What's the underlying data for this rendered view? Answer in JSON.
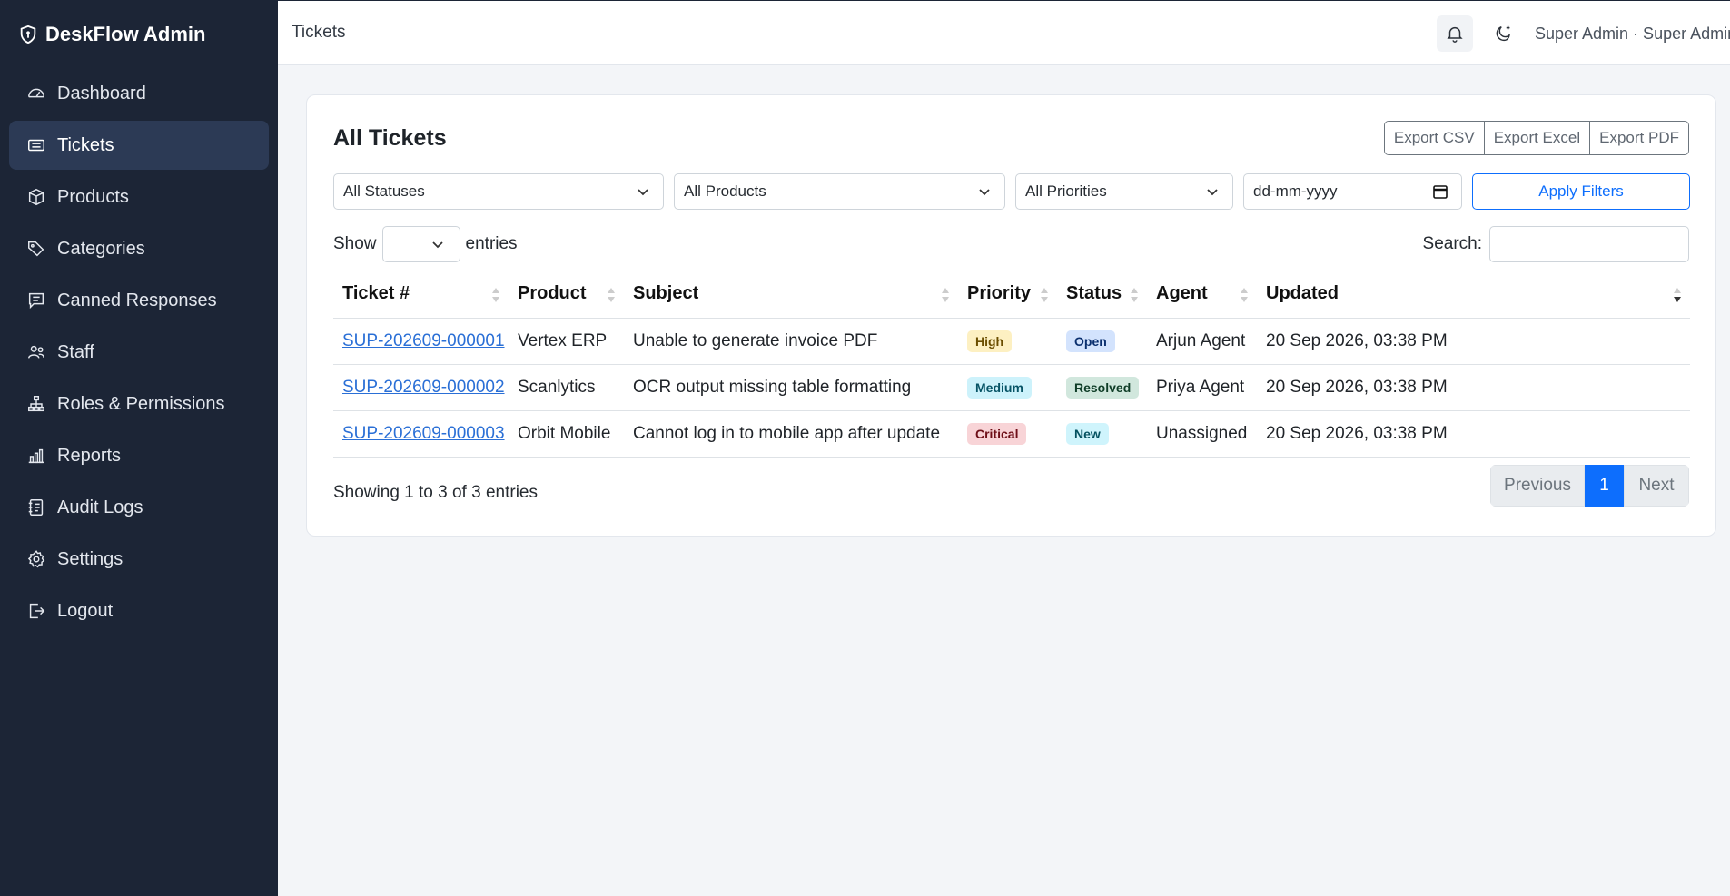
{
  "app": {
    "brand": "DeskFlow Admin"
  },
  "sidebar": {
    "items": [
      {
        "label": "Dashboard",
        "icon": "gauge-icon"
      },
      {
        "label": "Tickets",
        "icon": "ticket-icon",
        "active": true
      },
      {
        "label": "Products",
        "icon": "box-icon"
      },
      {
        "label": "Categories",
        "icon": "tags-icon"
      },
      {
        "label": "Canned Responses",
        "icon": "chat-text-icon"
      },
      {
        "label": "Staff",
        "icon": "people-icon"
      },
      {
        "label": "Roles & Permissions",
        "icon": "diagram-icon"
      },
      {
        "label": "Reports",
        "icon": "bar-chart-icon"
      },
      {
        "label": "Audit Logs",
        "icon": "journal-icon"
      },
      {
        "label": "Settings",
        "icon": "gear-icon"
      },
      {
        "label": "Logout",
        "icon": "logout-icon"
      }
    ]
  },
  "header": {
    "title": "Tickets",
    "user": "Super Admin · Super Admin"
  },
  "card": {
    "title": "All Tickets",
    "export": {
      "csv": "Export CSV",
      "excel": "Export Excel",
      "pdf": "Export PDF"
    },
    "filters": {
      "status": "All Statuses",
      "product": "All Products",
      "priority": "All Priorities",
      "date_placeholder": "dd-mm-yyyy",
      "apply": "Apply Filters"
    },
    "length": {
      "show": "Show",
      "entries": "entries"
    },
    "search_label": "Search:",
    "info": "Showing 1 to 3 of 3 entries",
    "pager": {
      "previous": "Previous",
      "current": "1",
      "next": "Next"
    }
  },
  "table": {
    "columns": [
      "Ticket #",
      "Product",
      "Subject",
      "Priority",
      "Status",
      "Agent",
      "Updated"
    ],
    "rows": [
      {
        "ticket": "SUP-202609-000001",
        "product": "Vertex ERP",
        "subject": "Unable to generate invoice PDF",
        "priority": "High",
        "status": "Open",
        "agent": "Arjun Agent",
        "updated": "20 Sep 2026, 03:38 PM"
      },
      {
        "ticket": "SUP-202609-000002",
        "product": "Scanlytics",
        "subject": "OCR output missing table formatting",
        "priority": "Medium",
        "status": "Resolved",
        "agent": "Priya Agent",
        "updated": "20 Sep 2026, 03:38 PM"
      },
      {
        "ticket": "SUP-202609-000003",
        "product": "Orbit Mobile",
        "subject": "Cannot log in to mobile app after update",
        "priority": "Critical",
        "status": "New",
        "agent": "Unassigned",
        "updated": "20 Sep 2026, 03:38 PM"
      }
    ]
  },
  "colors": {
    "sidebar_bg": "#1c2536",
    "active_item": "#2c3a55",
    "accent": "#0d6efd"
  }
}
